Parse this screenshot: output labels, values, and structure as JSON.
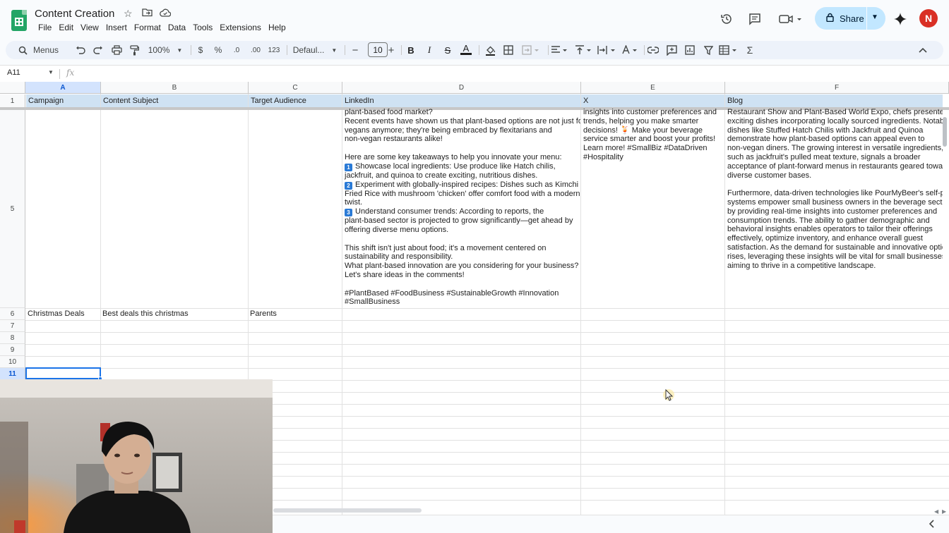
{
  "app": {
    "title": "Content Creation",
    "menu": [
      "File",
      "Edit",
      "View",
      "Insert",
      "Format",
      "Data",
      "Tools",
      "Extensions",
      "Help"
    ],
    "share_label": "Share",
    "avatar_initial": "N",
    "accent": "#0b57d0",
    "share_bg": "#c2e7ff",
    "avatar_color": "#d93025"
  },
  "toolbar": {
    "search_label": "Menus",
    "zoom": "100%",
    "currency": "$",
    "percent": "%",
    "dec_decrease": ".0",
    "dec_increase": ".00",
    "number_format": "123",
    "font": "Defaul...",
    "font_size": "10",
    "bold": "B",
    "italic": "I",
    "strike": "S",
    "text_color": "A",
    "text_color_value": "#1f1f1f"
  },
  "formula_bar": {
    "cell_ref": "A11",
    "fx": "fx",
    "content": ""
  },
  "sheet": {
    "columns": [
      "A",
      "B",
      "C",
      "D",
      "E",
      "F"
    ],
    "row_numbers": [
      "1",
      "5",
      "6",
      "7",
      "8",
      "9",
      "10",
      "11"
    ],
    "header_row": [
      "Campaign",
      "Content Subject",
      "Target Audience",
      "LinkedIn",
      "X",
      "Blog"
    ],
    "header_fill": "#cfe2f3",
    "row6": {
      "campaign": "Christmas Deals",
      "subject": "Best deals this christmas",
      "audience": "Parents"
    },
    "linkedin_lines": [
      "plant-based food market?",
      "Recent events have shown us that plant-based options are not just for",
      "vegans anymore; they're being embraced by flexitarians and",
      "non-vegan restaurants alike!",
      "",
      "Here are some key takeaways to help you innovate your menu:",
      "Showcase local ingredients: Use produce like Hatch chilis,",
      "jackfruit, and quinoa to create exciting, nutritious dishes.",
      "Experiment with globally-inspired recipes: Dishes such as Kimchi",
      "Fried Rice with mushroom 'chicken' offer comfort food with a modern",
      "twist.",
      "Understand consumer trends: According to reports, the",
      "plant-based sector is projected to grow significantly—get ahead by",
      "offering diverse menu options.",
      "",
      "This shift isn't just about food; it's a movement centered on",
      "sustainability and responsibility.",
      "What plant-based innovation are you considering for your business?",
      "Let's share ideas in the comments!",
      "",
      "#PlantBased #FoodBusiness #SustainableGrowth #Innovation",
      "#SmallBusiness"
    ],
    "linkedin_numbers": [
      "1",
      "2",
      "3"
    ],
    "x_lines": [
      "insights into customer preferences and",
      "trends, helping you make smarter",
      "decisions! 🍹 Make your beverage",
      "service smarter and boost your profits!",
      "Learn more! #SmallBiz #DataDriven",
      "#Hospitality"
    ],
    "blog_lines": [
      "Restaurant Show and Plant-Based World Expo, chefs presented",
      "exciting dishes incorporating locally sourced ingredients. Notably",
      "dishes like Stuffed Hatch Chilis with Jackfruit and Quinoa",
      "demonstrate how plant-based options can appeal even to",
      "non-vegan diners. The growing interest in versatile ingredients,",
      "such as jackfruit's pulled meat texture, signals a broader",
      "acceptance of plant-forward menus in restaurants geared toward",
      "diverse customer bases.",
      "",
      "Furthermore, data-driven technologies like PourMyBeer's self-po",
      "systems empower small business owners in the beverage sector",
      "by providing real-time insights into customer preferences and",
      "consumption trends. The ability to gather demographic and",
      "behavioral insights enables operators to tailor their offerings",
      "effectively, optimize inventory, and enhance overall guest",
      "satisfaction. As the demand for sustainable and innovative option",
      "rises, leveraging these insights will be vital for small businesses",
      "aiming to thrive in a competitive landscape."
    ]
  }
}
